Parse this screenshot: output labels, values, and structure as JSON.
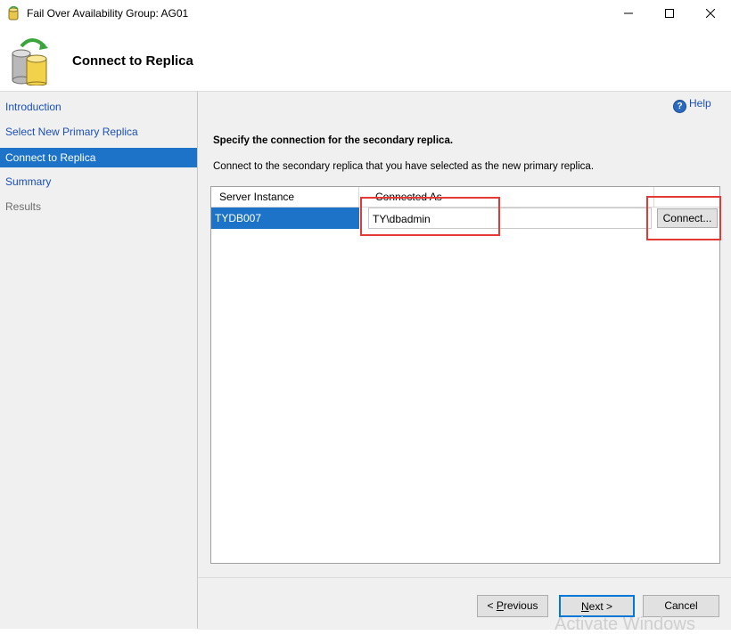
{
  "window": {
    "title": "Fail Over Availability Group: AG01",
    "controls": [
      "minimize-icon",
      "maximize-icon",
      "close-icon"
    ]
  },
  "header": {
    "title": "Connect to Replica",
    "icon": "database-failover-icon"
  },
  "sidebar": {
    "items": [
      {
        "label": "Introduction",
        "state": "link"
      },
      {
        "label": "Select New Primary Replica",
        "state": "link"
      },
      {
        "label": "Connect to Replica",
        "state": "selected"
      },
      {
        "label": "Summary",
        "state": "link"
      },
      {
        "label": "Results",
        "state": "disabled"
      }
    ]
  },
  "help": {
    "label": "Help",
    "icon": "help-icon"
  },
  "main": {
    "heading": "Specify the connection for the secondary replica.",
    "description": "Connect to the secondary replica that you have selected as the new primary replica."
  },
  "grid": {
    "columns": [
      "Server Instance",
      "Connected As"
    ],
    "rows": [
      {
        "server_instance": "TYDB007",
        "connected_as": "TY\\dbadmin",
        "button": "Connect..."
      }
    ]
  },
  "footer": {
    "previous": {
      "prefix": "< ",
      "hotkey": "P",
      "rest": "revious"
    },
    "next": {
      "hotkey": "N",
      "rest": "ext >"
    },
    "cancel": "Cancel"
  },
  "watermark": "Activate Windows",
  "colors": {
    "selection": "#1c73c7",
    "link": "#1a4fb5",
    "highlight_box": "#e53935",
    "focus": "#0078d7"
  }
}
